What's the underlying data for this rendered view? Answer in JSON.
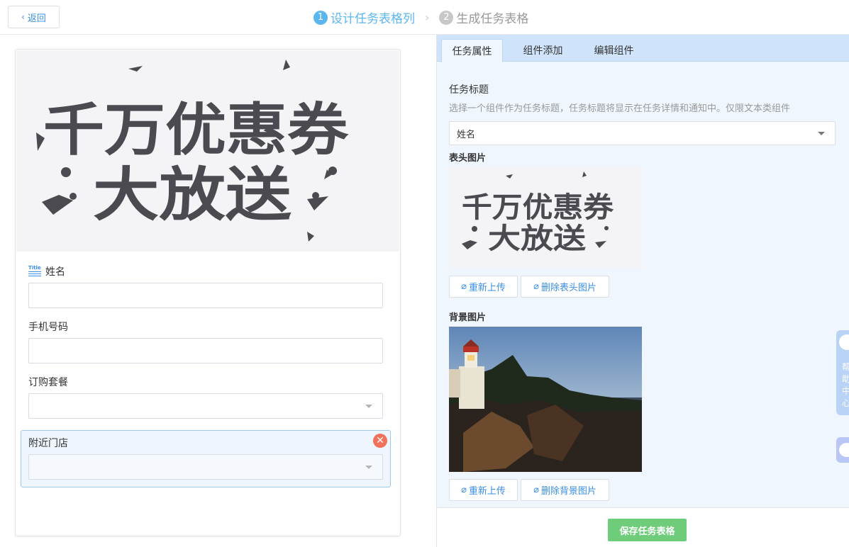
{
  "topbar": {
    "back_label": "返回",
    "steps": [
      {
        "num": "1",
        "label": "设计任务表格列"
      },
      {
        "num": "2",
        "label": "生成任务表格"
      }
    ]
  },
  "preview": {
    "banner_text_line1": "千万优惠券",
    "banner_text_line2": "大放送",
    "fields": [
      {
        "label": "姓名",
        "type": "text"
      },
      {
        "label": "手机号码",
        "type": "text"
      },
      {
        "label": "订购套餐",
        "type": "select"
      },
      {
        "label": "附近门店",
        "type": "select"
      }
    ]
  },
  "panel": {
    "tabs": [
      "任务属性",
      "组件添加",
      "编辑组件"
    ],
    "task_title_label": "任务标题",
    "task_title_hint": "选择一个组件作为任务标题，任务标题将显示在任务详情和通知中。仅限文本类组件",
    "task_title_value": "姓名",
    "header_image_label": "表头图片",
    "reupload_label": "重新上传",
    "delete_header_label": "删除表头图片",
    "background_image_label": "背景图片",
    "delete_background_label": "删除背景图片",
    "save_label": "保存任务表格"
  },
  "side": {
    "help_label": "帮助中心"
  },
  "colors": {
    "accent": "#3a8ee6",
    "step_active": "#5bb6ef",
    "save_green": "#6fcc7a",
    "delete_red": "#f0725c"
  }
}
